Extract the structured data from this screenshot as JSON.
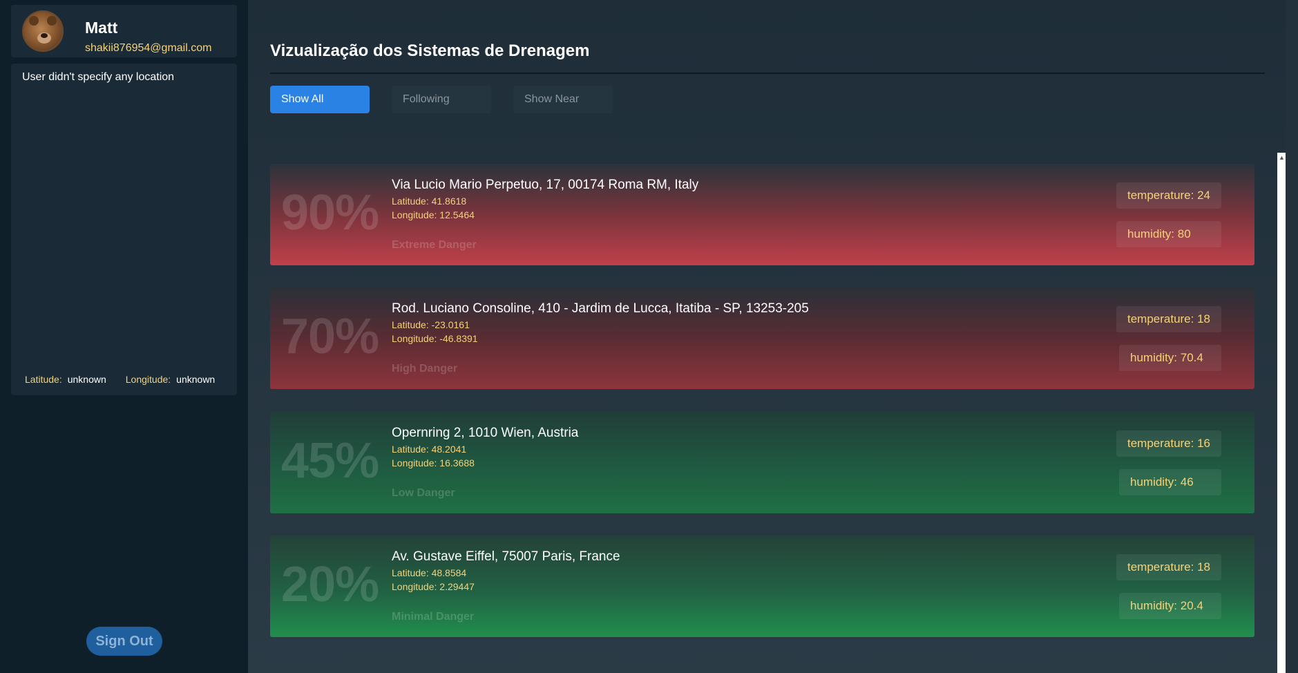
{
  "user": {
    "name": "Matt",
    "email": "shakii876954@gmail.com"
  },
  "location": {
    "message": "User didn't specify any location",
    "latitude_label": "Latitude:",
    "latitude_value": "unknown",
    "longitude_label": "Longitude:",
    "longitude_value": "unknown"
  },
  "sign_out_label": "Sign Out",
  "main": {
    "title": "Vizualização dos Sistemas de Drenagem",
    "filters": [
      "Show All",
      "Following",
      "Show Near"
    ],
    "active_filter": "Show All"
  },
  "cards": [
    {
      "percent": "90%",
      "address": "Via Lucio Mario Perpetuo, 17, 00174 Roma RM, Italy",
      "latitude": "Latitude: 41.8618",
      "longitude": "Longitude: 12.5464",
      "danger": "Extreme Danger",
      "temperature": "temperature: 24",
      "humidity": "humidity: 80",
      "color": "#c0404a"
    },
    {
      "percent": "70%",
      "address": "Rod. Luciano Consoline, 410 - Jardim de Lucca, Itatiba - SP, 13253-205",
      "latitude": "Latitude: -23.0161",
      "longitude": "Longitude: -46.8391",
      "danger": "High Danger",
      "temperature": "temperature: 18",
      "humidity": "humidity: 70.4",
      "color": "#8e343c"
    },
    {
      "percent": "45%",
      "address": "Opernring 2, 1010 Wien, Austria",
      "latitude": "Latitude: 48.2041",
      "longitude": "Longitude: 16.3688",
      "danger": "Low Danger",
      "temperature": "temperature: 16",
      "humidity": "humidity: 46",
      "color": "#1f7044"
    },
    {
      "percent": "20%",
      "address": "Av. Gustave Eiffel, 75007 Paris, France",
      "latitude": "Latitude: 48.8584",
      "longitude": "Longitude: 2.29447",
      "danger": "Minimal Danger",
      "temperature": "temperature: 18",
      "humidity": "humidity: 20.4",
      "color": "#218e4d"
    }
  ],
  "colors": {
    "accent": "#2a82e4",
    "highlight_text": "#f4d27a",
    "sidebar_bg": "#0e1f2a"
  },
  "icons": [
    "avatar-image",
    "scroll-up-arrow-icon"
  ]
}
